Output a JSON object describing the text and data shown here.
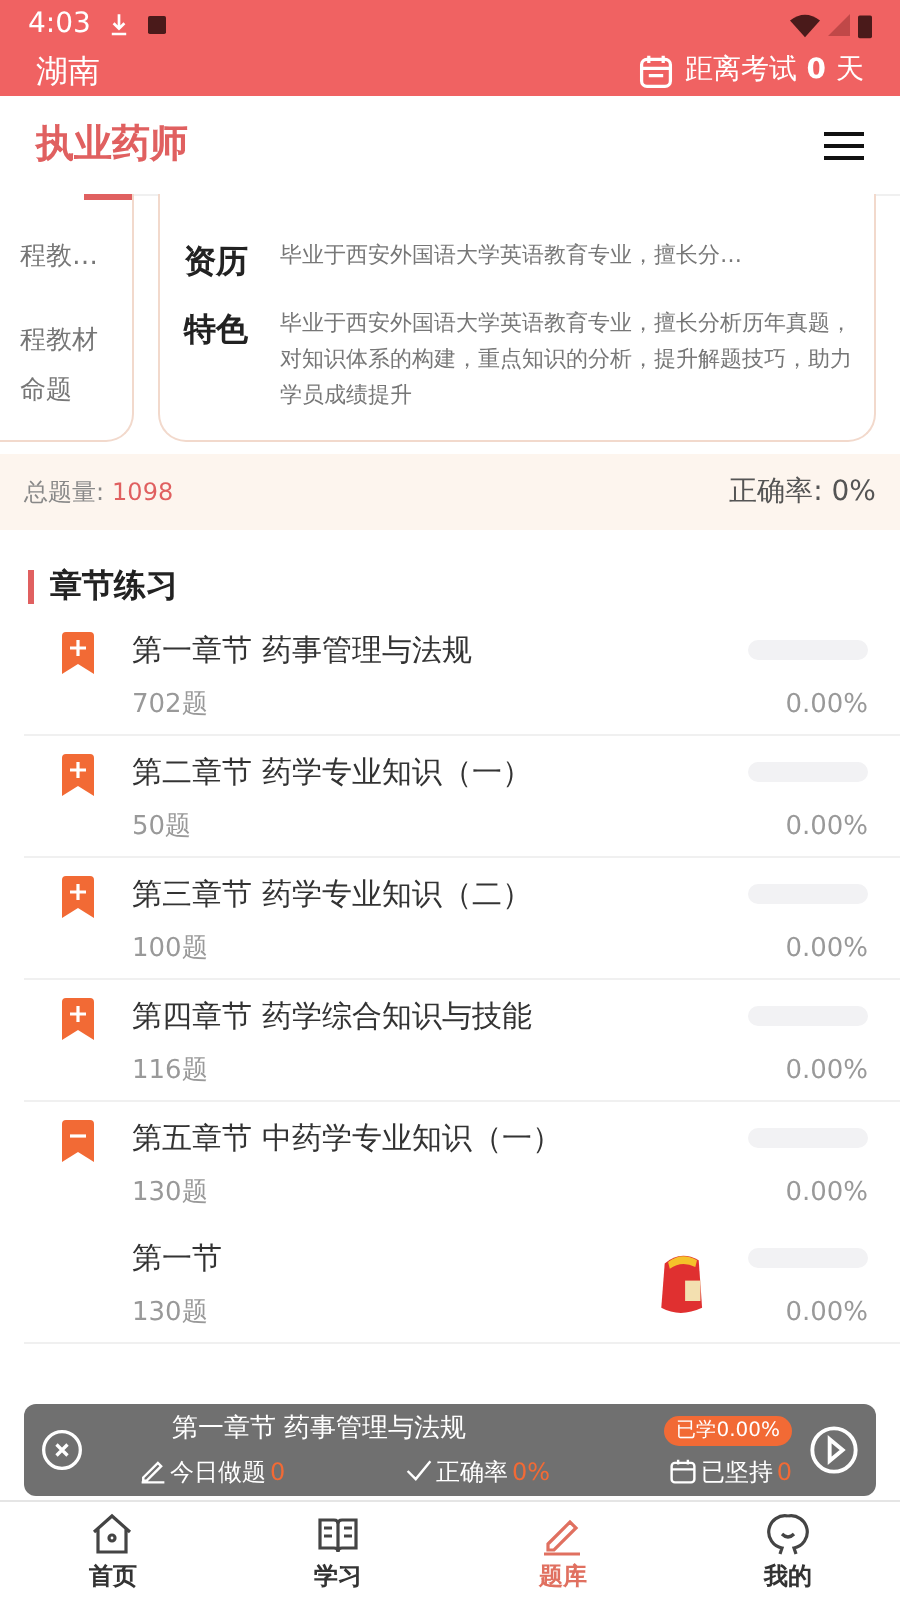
{
  "status_bar": {
    "time": "4:03"
  },
  "top_bar": {
    "region": "湖南",
    "countdown_label": "距离考试",
    "countdown_value": "0",
    "countdown_unit": "天"
  },
  "header": {
    "title": "执业药师"
  },
  "teacher_cards": {
    "left_lines": [
      "程教…",
      "程教材",
      "命题"
    ],
    "rows": [
      {
        "label": "资历",
        "text": "毕业于西安外国语大学英语教育专业，擅长分…"
      },
      {
        "label": "特色",
        "text": "毕业于西安外国语大学英语教育专业，擅长分析历年真题，对知识体系的构建，重点知识的分析，提升解题技巧，助力学员成绩提升"
      }
    ]
  },
  "stats": {
    "total_label": "总题量:",
    "total_value": "1098",
    "accuracy": "正确率: 0%"
  },
  "section_title": "章节练习",
  "chapters": [
    {
      "title": "第一章节 药事管理与法规",
      "count": "702题",
      "percent": "0.00%",
      "level": 0,
      "expanded": false
    },
    {
      "title": "第二章节 药学专业知识（一）",
      "count": "50题",
      "percent": "0.00%",
      "level": 0,
      "expanded": false
    },
    {
      "title": "第三章节 药学专业知识（二）",
      "count": "100题",
      "percent": "0.00%",
      "level": 0,
      "expanded": false
    },
    {
      "title": "第四章节 药学综合知识与技能",
      "count": "116题",
      "percent": "0.00%",
      "level": 0,
      "expanded": false
    },
    {
      "title": "第五章节 中药学专业知识（一）",
      "count": "130题",
      "percent": "0.00%",
      "level": 0,
      "expanded": true,
      "children": [
        {
          "title": "第一节",
          "count": "130题",
          "percent": "0.00%",
          "level": 0
        }
      ]
    }
  ],
  "resume_bar": {
    "title": "第一章节 药事管理与法规",
    "badge": "已学0.00%",
    "today_label": "今日做题",
    "today_value": "0",
    "accuracy_label": "正确率",
    "accuracy_value": "0%",
    "streak_label": "已坚持",
    "streak_value": "0"
  },
  "nav": [
    {
      "label": "首页",
      "selected": false
    },
    {
      "label": "学习",
      "selected": false
    },
    {
      "label": "题库",
      "selected": true
    },
    {
      "label": "我的",
      "selected": false
    }
  ]
}
